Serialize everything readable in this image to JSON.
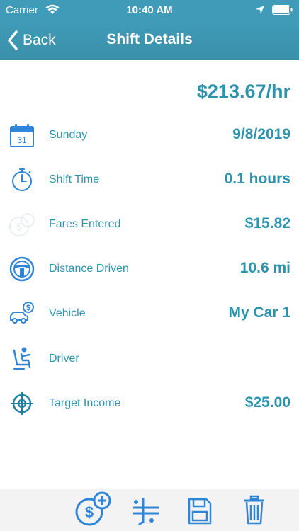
{
  "status_bar": {
    "carrier": "Carrier",
    "time": "10:40 AM"
  },
  "nav": {
    "back_label": "Back",
    "title": "Shift Details"
  },
  "summary": {
    "rate": "$213.67/hr"
  },
  "rows": [
    {
      "icon": "calendar-icon",
      "label": "Sunday",
      "value": "9/8/2019",
      "calendar_day": "31"
    },
    {
      "icon": "stopwatch-icon",
      "label": "Shift Time",
      "value": "0.1 hours"
    },
    {
      "icon": "fares-coins-icon",
      "label": "Fares Entered",
      "value": "$15.82"
    },
    {
      "icon": "steering-wheel-icon",
      "label": "Distance Driven",
      "value": "10.6 mi"
    },
    {
      "icon": "car-dollar-icon",
      "label": "Vehicle",
      "value": "My Car 1"
    },
    {
      "icon": "driver-seat-icon",
      "label": "Driver",
      "value": ""
    },
    {
      "icon": "target-icon",
      "label": "Target Income",
      "value": "$25.00"
    }
  ],
  "toolbar": {
    "items": [
      "add-fare-icon",
      "split-route-icon",
      "save-icon",
      "trash-icon"
    ]
  },
  "colors": {
    "nav_background": "#3f9bb7",
    "accent_text": "#2c93ad",
    "icon_blue": "#2f86d8"
  }
}
